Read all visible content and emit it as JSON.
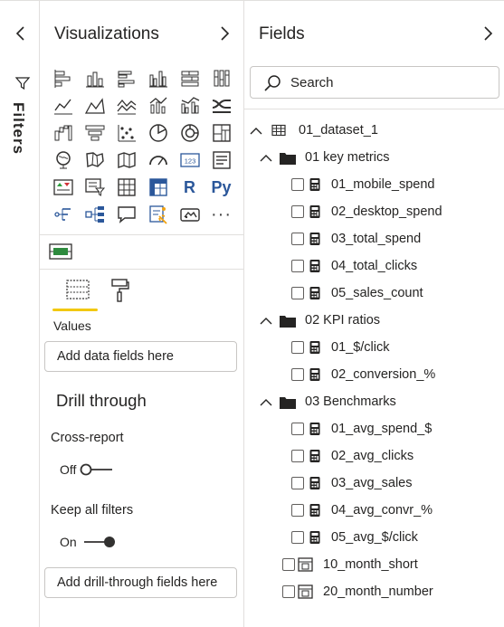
{
  "filters": {
    "label": "Filters"
  },
  "visualizations": {
    "title": "Visualizations",
    "icons": [
      "stacked-bar-chart-icon",
      "stacked-column-chart-icon",
      "clustered-bar-chart-icon",
      "clustered-column-chart-icon",
      "100-stacked-bar-chart-icon",
      "100-stacked-column-chart-icon",
      "line-chart-icon",
      "area-chart-icon",
      "stacked-area-chart-icon",
      "line-and-column-chart-icon",
      "line-and-clustered-column-chart-icon",
      "ribbon-chart-icon",
      "waterfall-chart-icon",
      "funnel-chart-icon",
      "scatter-chart-icon",
      "pie-chart-icon",
      "donut-chart-icon",
      "treemap-icon",
      "map-icon",
      "filled-map-icon",
      "shape-map-icon",
      "gauge-icon",
      "card-icon",
      "multi-row-card-icon",
      "kpi-icon",
      "slicer-icon",
      "table-icon",
      "matrix-icon",
      "r-visual-icon",
      "python-visual-icon",
      "key-influencers-icon",
      "decomposition-tree-icon",
      "qa-icon",
      "smart-narrative-icon",
      "paginated-report-icon",
      "more-visuals-icon"
    ],
    "card_text": "123",
    "r_text": "R",
    "py_text": "Py",
    "more_text": "···",
    "values_label": "Values",
    "values_placeholder": "Add data fields here",
    "drill_title": "Drill through",
    "cross_report_label": "Cross-report",
    "cross_report_state": "Off",
    "keep_filters_label": "Keep all filters",
    "keep_filters_state": "On",
    "drill_placeholder": "Add drill-through fields here"
  },
  "fields": {
    "title": "Fields",
    "search_placeholder": "Search",
    "table": {
      "name": "01_dataset_1"
    },
    "folders": [
      {
        "name": "01 key metrics",
        "measures": [
          "01_mobile_spend",
          "02_desktop_spend",
          "03_total_spend",
          "04_total_clicks",
          "05_sales_count"
        ]
      },
      {
        "name": "02 KPI ratios",
        "measures": [
          "01_$/click",
          "02_conversion_%"
        ]
      },
      {
        "name": "03 Benchmarks",
        "measures": [
          "01_avg_spend_$",
          "02_avg_clicks",
          "03_avg_sales",
          "04_avg_convr_%",
          "05_avg_$/click"
        ]
      }
    ],
    "columns": [
      "10_month_short",
      "20_month_number"
    ]
  },
  "colors": {
    "accent_underline": "#f2c811",
    "icon_blue": "#2b579a",
    "icon_dark": "#323130"
  }
}
